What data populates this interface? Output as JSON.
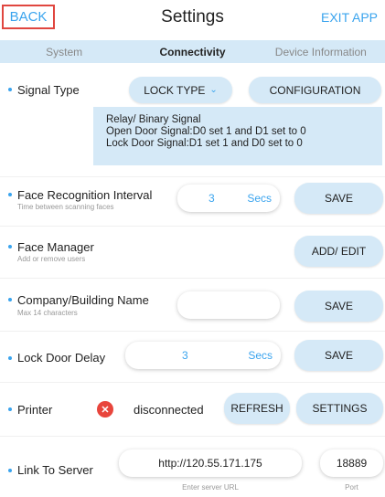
{
  "header": {
    "back_label": "BACK",
    "title": "Settings",
    "exit_label": "EXIT APP"
  },
  "tabs": [
    {
      "label": "System",
      "active": false
    },
    {
      "label": "Connectivity",
      "active": true
    },
    {
      "label": "Device Information",
      "active": false
    }
  ],
  "signal_type": {
    "label": "Signal Type",
    "lock_type_label": "LOCK TYPE",
    "configuration_label": "CONFIGURATION",
    "info": [
      "Relay/ Binary Signal",
      "Open Door Signal:D0 set 1 and D1 set to 0",
      "Lock Door Signal:D1 set 1 and D0 set to 0"
    ]
  },
  "face_recognition": {
    "label": "Face Recognition Interval",
    "sub": "Time between scanning faces",
    "value": "3",
    "unit": "Secs",
    "save_label": "SAVE"
  },
  "face_manager": {
    "label": "Face Manager",
    "sub": "Add or remove users",
    "button_label": "ADD/ EDIT"
  },
  "company": {
    "label": "Company/Building Name",
    "sub": "Max 14 characters",
    "value": "",
    "save_label": "SAVE"
  },
  "lock_delay": {
    "label": "Lock Door Delay",
    "value": "3",
    "unit": "Secs",
    "save_label": "SAVE"
  },
  "printer": {
    "label": "Printer",
    "status": "disconnected",
    "refresh_label": "REFRESH",
    "settings_label": "SETTINGS"
  },
  "server": {
    "label": "Link To Server",
    "url": "http://120.55.171.175",
    "url_caption": "Enter server URL",
    "port": "18889",
    "port_caption": "Port"
  },
  "colors": {
    "accent": "#3aa4ee",
    "pill_bg": "#d5e9f7",
    "error": "#e8453c",
    "highlight_border": "#e0463f"
  }
}
